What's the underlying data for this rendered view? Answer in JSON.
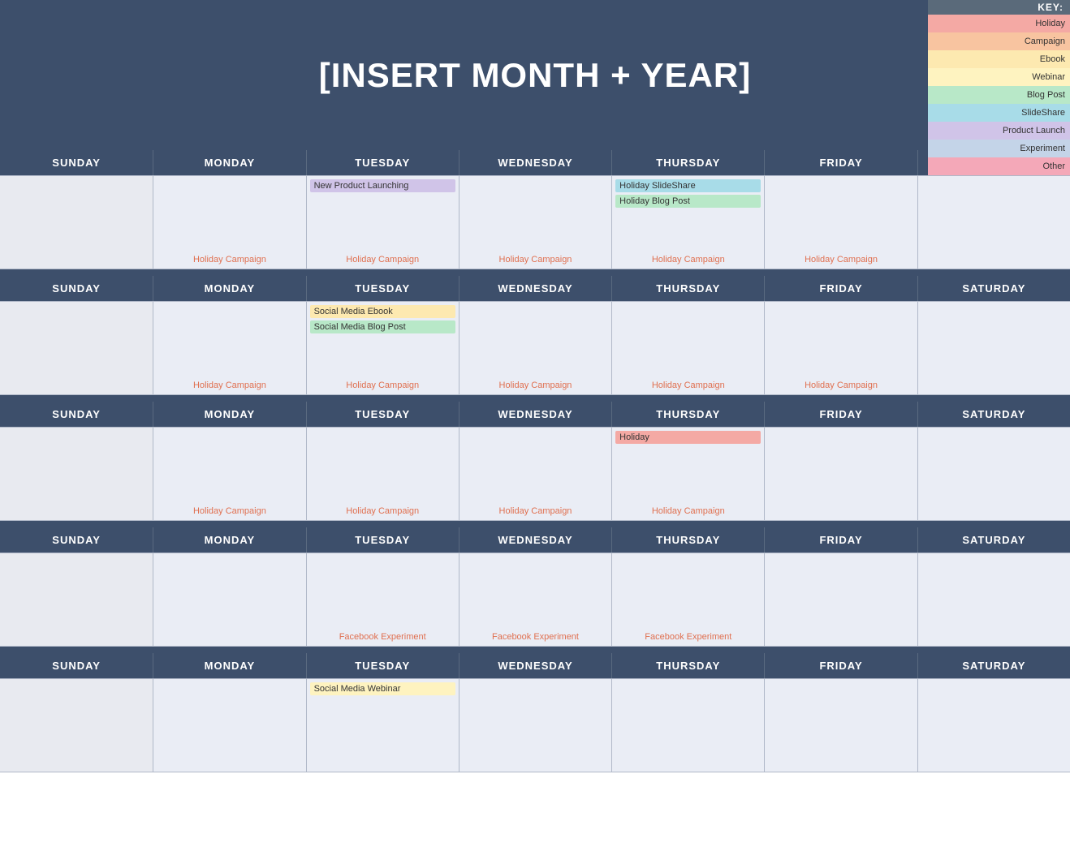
{
  "header": {
    "title": "[INSERT MONTH + YEAR]"
  },
  "key": {
    "title": "KEY:",
    "items": [
      {
        "label": "Holiday",
        "colorClass": "kc-holiday"
      },
      {
        "label": "Campaign",
        "colorClass": "kc-campaign"
      },
      {
        "label": "Ebook",
        "colorClass": "kc-ebook"
      },
      {
        "label": "Webinar",
        "colorClass": "kc-webinar"
      },
      {
        "label": "Blog Post",
        "colorClass": "kc-blogpost"
      },
      {
        "label": "SlideShare",
        "colorClass": "kc-slideshare"
      },
      {
        "label": "Product Launch",
        "colorClass": "kc-productlaunch"
      },
      {
        "label": "Experiment",
        "colorClass": "kc-experiment"
      },
      {
        "label": "Other",
        "colorClass": "kc-other"
      }
    ]
  },
  "days": {
    "headers": [
      "SUNDAY",
      "MONDAY",
      "TUESDAY",
      "WEDNESDAY",
      "THURSDAY",
      "FRIDAY",
      "SATURDAY"
    ]
  },
  "weeks": [
    {
      "cells": [
        {
          "events": [],
          "bottomLabel": "",
          "bottomClass": ""
        },
        {
          "events": [],
          "bottomLabel": "Holiday Campaign",
          "bottomClass": "label-campaign"
        },
        {
          "events": [
            {
              "text": "New Product Launching",
              "cls": "event-productlaunch"
            }
          ],
          "bottomLabel": "Holiday Campaign",
          "bottomClass": "label-campaign"
        },
        {
          "events": [],
          "bottomLabel": "Holiday Campaign",
          "bottomClass": "label-campaign"
        },
        {
          "events": [
            {
              "text": "Holiday SlideShare",
              "cls": "event-slideshare"
            },
            {
              "text": "Holiday Blog Post",
              "cls": "event-blogpost"
            }
          ],
          "bottomLabel": "Holiday Campaign",
          "bottomClass": "label-campaign"
        },
        {
          "events": [],
          "bottomLabel": "Holiday Campaign",
          "bottomClass": "label-campaign"
        },
        {
          "events": [],
          "bottomLabel": "",
          "bottomClass": ""
        }
      ]
    },
    {
      "cells": [
        {
          "events": [],
          "bottomLabel": "",
          "bottomClass": ""
        },
        {
          "events": [],
          "bottomLabel": "Holiday Campaign",
          "bottomClass": "label-campaign"
        },
        {
          "events": [
            {
              "text": "Social Media Ebook",
              "cls": "event-ebook"
            },
            {
              "text": "Social Media Blog Post",
              "cls": "event-blogpost"
            }
          ],
          "bottomLabel": "Holiday Campaign",
          "bottomClass": "label-campaign"
        },
        {
          "events": [],
          "bottomLabel": "Holiday Campaign",
          "bottomClass": "label-campaign"
        },
        {
          "events": [],
          "bottomLabel": "Holiday Campaign",
          "bottomClass": "label-campaign"
        },
        {
          "events": [],
          "bottomLabel": "Holiday Campaign",
          "bottomClass": "label-campaign"
        },
        {
          "events": [],
          "bottomLabel": "",
          "bottomClass": ""
        }
      ]
    },
    {
      "cells": [
        {
          "events": [],
          "bottomLabel": "",
          "bottomClass": ""
        },
        {
          "events": [],
          "bottomLabel": "Holiday Campaign",
          "bottomClass": "label-campaign"
        },
        {
          "events": [],
          "bottomLabel": "Holiday Campaign",
          "bottomClass": "label-campaign"
        },
        {
          "events": [],
          "bottomLabel": "Holiday Campaign",
          "bottomClass": "label-campaign"
        },
        {
          "events": [
            {
              "text": "Holiday",
              "cls": "event-holiday"
            }
          ],
          "bottomLabel": "Holiday Campaign",
          "bottomClass": "label-campaign"
        },
        {
          "events": [],
          "bottomLabel": "",
          "bottomClass": ""
        },
        {
          "events": [],
          "bottomLabel": "",
          "bottomClass": ""
        }
      ]
    },
    {
      "cells": [
        {
          "events": [],
          "bottomLabel": "",
          "bottomClass": ""
        },
        {
          "events": [],
          "bottomLabel": "",
          "bottomClass": ""
        },
        {
          "events": [],
          "bottomLabel": "Facebook Experiment",
          "bottomClass": "label-campaign"
        },
        {
          "events": [],
          "bottomLabel": "Facebook Experiment",
          "bottomClass": "label-campaign"
        },
        {
          "events": [],
          "bottomLabel": "Facebook Experiment",
          "bottomClass": "label-campaign"
        },
        {
          "events": [],
          "bottomLabel": "",
          "bottomClass": ""
        },
        {
          "events": [],
          "bottomLabel": "",
          "bottomClass": ""
        }
      ]
    },
    {
      "cells": [
        {
          "events": [],
          "bottomLabel": "",
          "bottomClass": ""
        },
        {
          "events": [],
          "bottomLabel": "",
          "bottomClass": ""
        },
        {
          "events": [
            {
              "text": "Social Media Webinar",
              "cls": "event-webinar"
            }
          ],
          "bottomLabel": "",
          "bottomClass": ""
        },
        {
          "events": [],
          "bottomLabel": "",
          "bottomClass": ""
        },
        {
          "events": [],
          "bottomLabel": "",
          "bottomClass": ""
        },
        {
          "events": [],
          "bottomLabel": "",
          "bottomClass": ""
        },
        {
          "events": [],
          "bottomLabel": "",
          "bottomClass": ""
        }
      ]
    }
  ]
}
